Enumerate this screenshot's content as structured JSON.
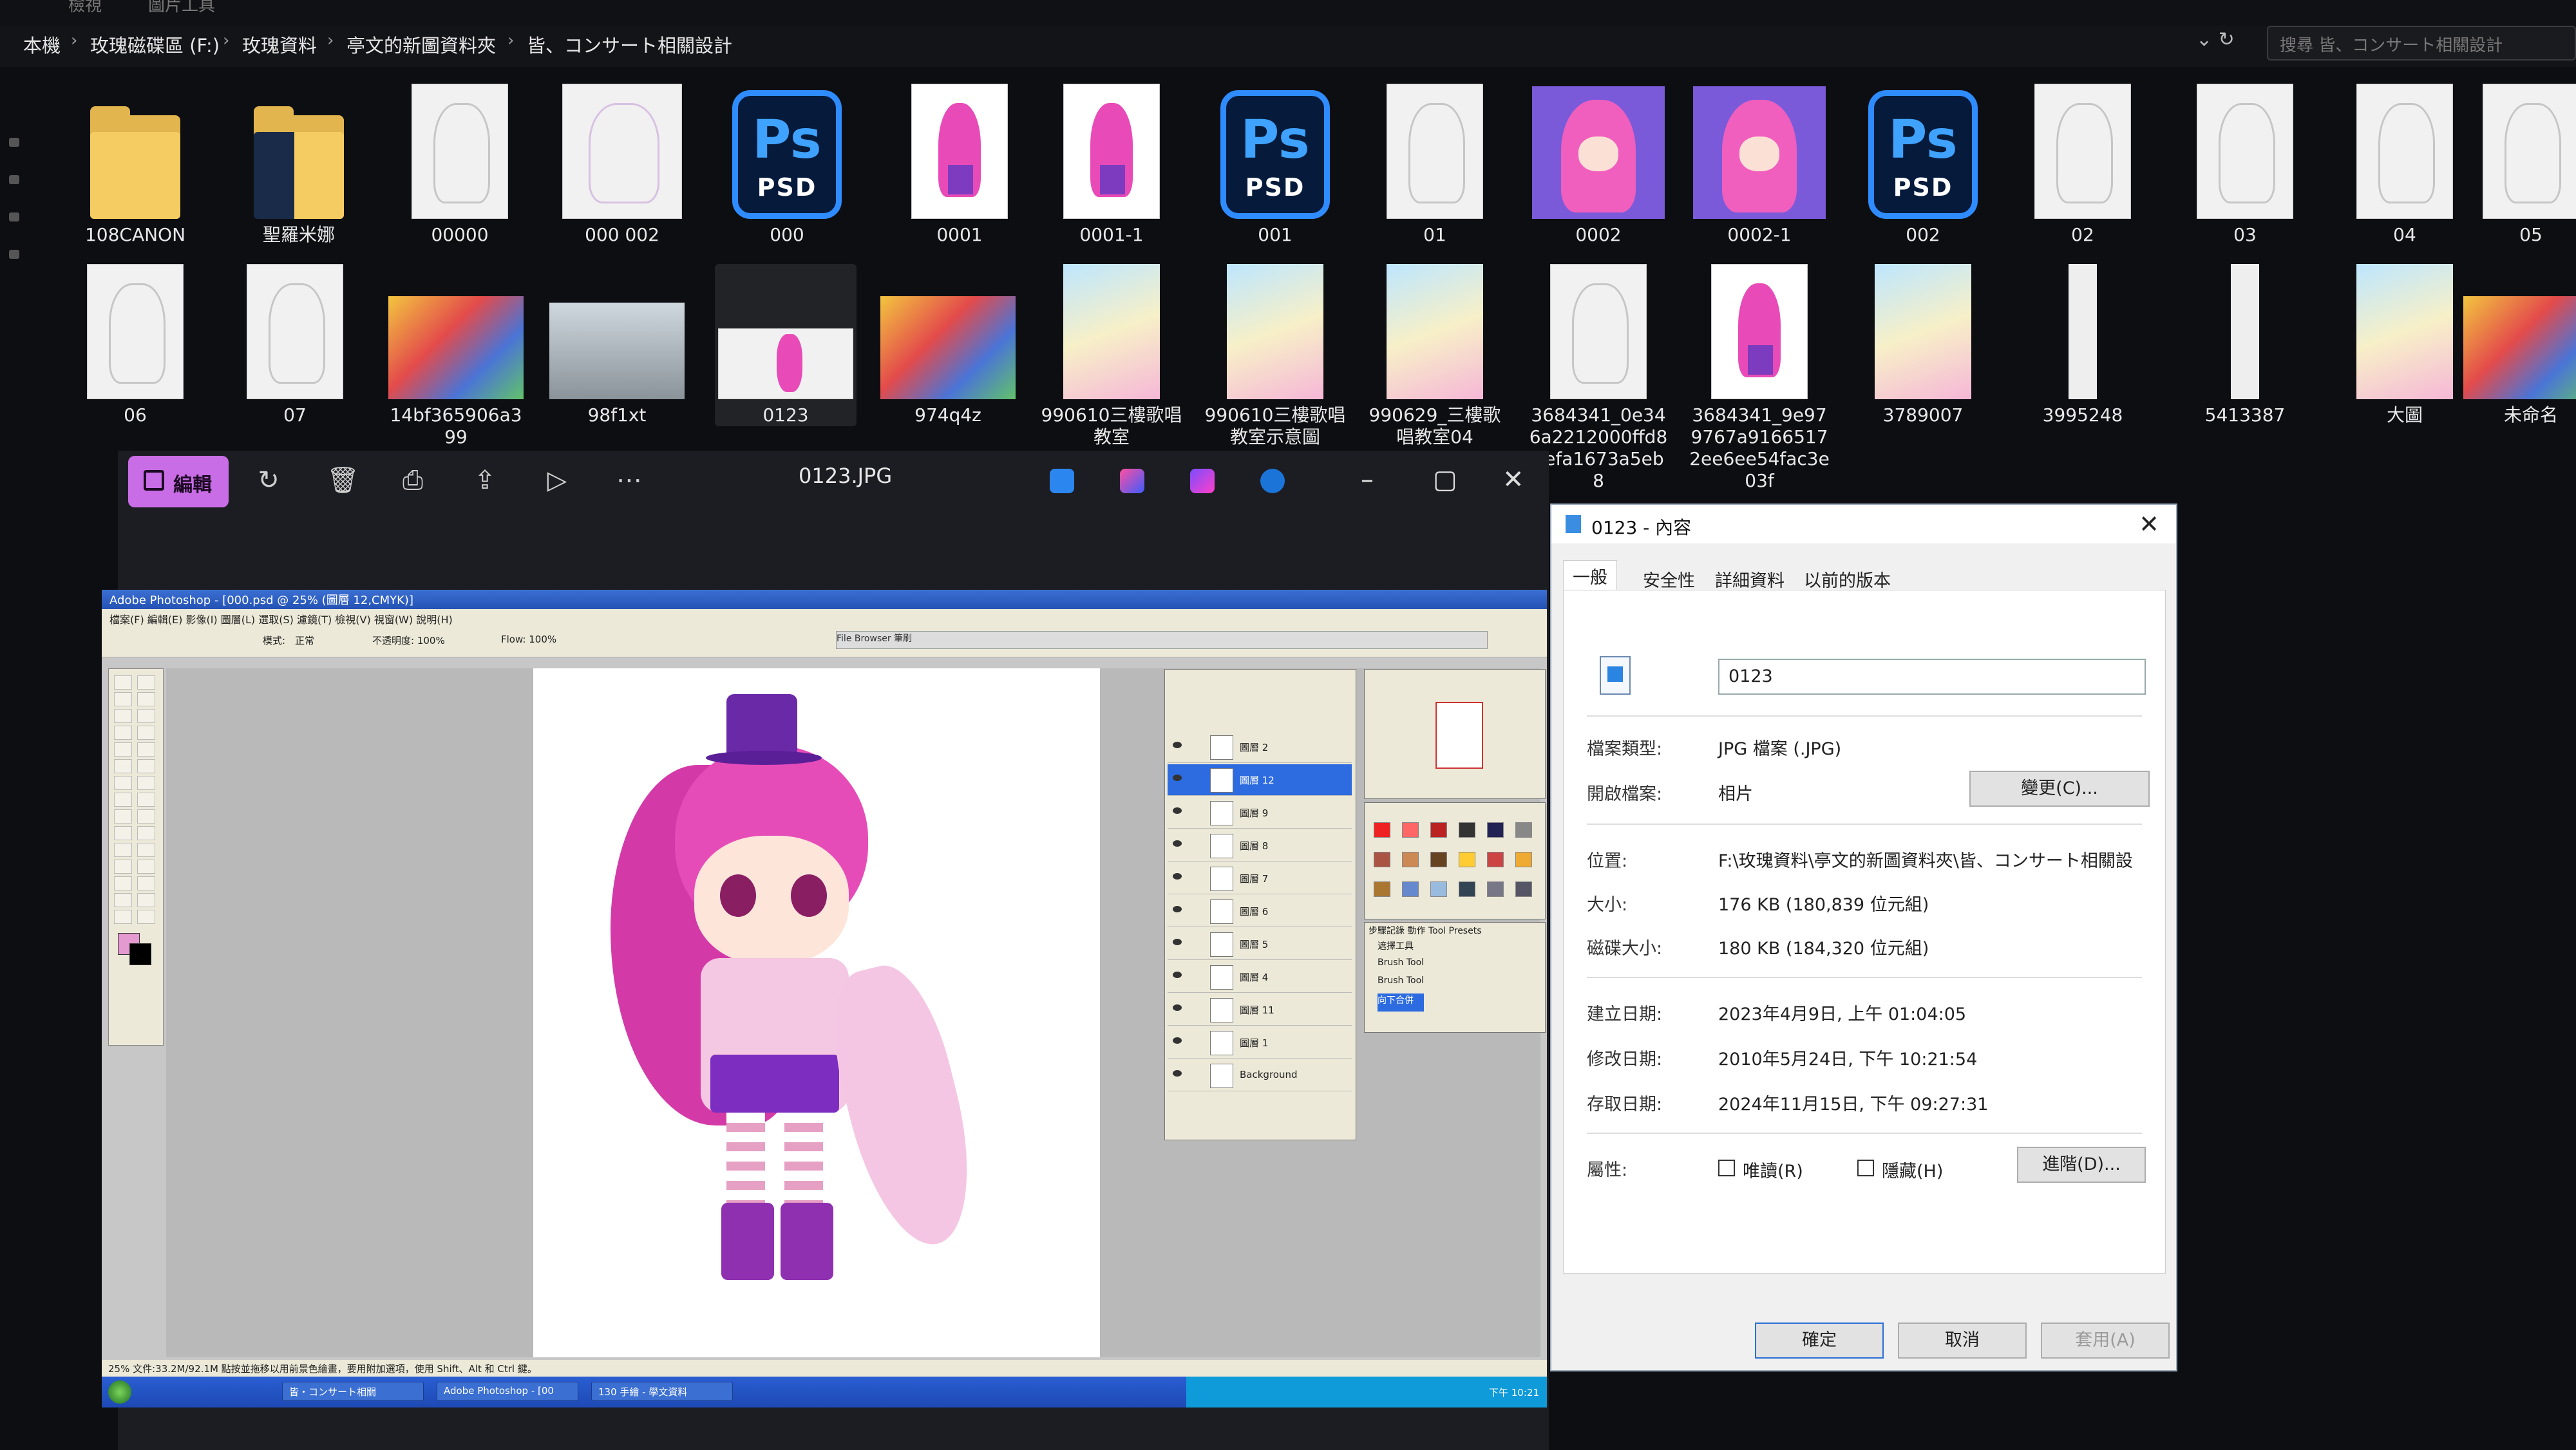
{
  "explorer": {
    "menu": [
      "檢視",
      "圖片工具"
    ],
    "breadcrumbs": [
      "本機",
      "玫瑰磁碟區 (F:)",
      "玫瑰資料",
      "亭文的新圖資料夾",
      "皆、コンサート相關設計"
    ],
    "search_placeholder": "搜尋 皆、コンサート相關設計",
    "files_row1": [
      {
        "name": "108CANON",
        "kind": "folder"
      },
      {
        "name": "聖羅米娜",
        "kind": "folder-psd"
      },
      {
        "name": "00000",
        "kind": "sketch"
      },
      {
        "name": "000 002",
        "kind": "purple-sketch"
      },
      {
        "name": "000",
        "kind": "psd"
      },
      {
        "name": "0001",
        "kind": "pinkgirl"
      },
      {
        "name": "0001-1",
        "kind": "pinkgirl"
      },
      {
        "name": "001",
        "kind": "psd"
      },
      {
        "name": "01",
        "kind": "sketch"
      },
      {
        "name": "0002",
        "kind": "dotbg"
      },
      {
        "name": "0002-1",
        "kind": "dotbg"
      },
      {
        "name": "002",
        "kind": "psd"
      },
      {
        "name": "02",
        "kind": "sketch"
      },
      {
        "name": "03",
        "kind": "sketch"
      },
      {
        "name": "04",
        "kind": "sketch"
      },
      {
        "name": "05",
        "kind": "sketch"
      }
    ],
    "files_row2": [
      {
        "name": "06",
        "kind": "sketch"
      },
      {
        "name": "07",
        "kind": "sketch"
      },
      {
        "name": "14bf365906a399",
        "kind": "colorful"
      },
      {
        "name": "98f1xt",
        "kind": "ship"
      },
      {
        "name": "0123",
        "kind": "selected"
      },
      {
        "name": "974q4z",
        "kind": "colorful"
      },
      {
        "name": "990610三樓歌唱教室",
        "kind": "poster"
      },
      {
        "name": "990610三樓歌唱教室示意圖",
        "kind": "poster"
      },
      {
        "name": "990629_三樓歌唱教室04",
        "kind": "poster"
      },
      {
        "name": "3684341_0e346a2212000ffd89efa1673a5eb8",
        "kind": "sketch"
      },
      {
        "name": "3684341_9e979767a91665172ee6ee54fac3e03f",
        "kind": "pinkgirl"
      },
      {
        "name": "3789007",
        "kind": "poster"
      },
      {
        "name": "3995248",
        "kind": "strip"
      },
      {
        "name": "5413387",
        "kind": "strip"
      },
      {
        "name": "大圖",
        "kind": "poster"
      },
      {
        "name": "未命名",
        "kind": "colorful"
      }
    ]
  },
  "viewer": {
    "edit_label": "編輯",
    "title": "0123.JPG",
    "icons": [
      "rotate-icon",
      "delete-icon",
      "print-icon",
      "share-icon",
      "slideshow-icon",
      "more-icon"
    ]
  },
  "photoshop": {
    "title": "Adobe Photoshop - [000.psd @ 25% (圖層 12,CMYK)]",
    "menu": "檔案(F)  編輯(E)  影像(I)  圖層(L)  選取(S)  濾鏡(T)  檢視(V)  視窗(W)  說明(H)",
    "opt_mode_label": "模式:",
    "opt_mode_value": "正常",
    "opt_opacity": "不透明度: 100%",
    "opt_flow": "Flow: 100%",
    "well_tabs": "File Browser    筆刷",
    "layers": [
      "圖層 2",
      "圖層 12",
      "圖層 9",
      "圖層 8",
      "圖層 7",
      "圖層 6",
      "圖層 5",
      "圖層 4",
      "圖層 11",
      "圖層 1",
      "Background"
    ],
    "active_layer_index": 1,
    "history_items": [
      "遮擇工具",
      "Brush Tool",
      "Brush Tool",
      "向下合併"
    ],
    "history_tabs": "步驟記錄  動作  Tool Presets",
    "status": "25%    文件:33.2M/92.1M    點按並拖移以用前景色繪畫，要用附加選項，使用 Shift、Alt 和 Ctrl 鍵。",
    "taskbar": [
      "皆・コンサート相關",
      "Adobe Photoshop - [00",
      "130 手繪 - 學文資料"
    ],
    "clock": "下午 10:21"
  },
  "properties": {
    "title": "0123 - 內容",
    "tabs": [
      "一般",
      "安全性",
      "詳細資料",
      "以前的版本"
    ],
    "name": "0123",
    "rows": [
      {
        "label": "檔案類型:",
        "value": "JPG 檔案 (.JPG)"
      },
      {
        "label": "開啟檔案:",
        "value": "相片"
      },
      {
        "label": "位置:",
        "value": "F:\\玫瑰資料\\亭文的新圖資料夾\\皆、コンサート相關設"
      },
      {
        "label": "大小:",
        "value": "176 KB (180,839 位元組)"
      },
      {
        "label": "磁碟大小:",
        "value": "180 KB (184,320 位元組)"
      },
      {
        "label": "建立日期:",
        "value": "2023年4月9日, 上午 01:04:05"
      },
      {
        "label": "修改日期:",
        "value": "2010年5月24日, 下午 10:21:54"
      },
      {
        "label": "存取日期:",
        "value": "2024年11月15日, 下午 09:27:31"
      },
      {
        "label": "屬性:",
        "value": ""
      }
    ],
    "change_button": "變更(C)...",
    "readonly_label": "唯讀(R)",
    "hidden_label": "隱藏(H)",
    "advanced_button": "進階(D)...",
    "ok_button": "確定",
    "cancel_button": "取消",
    "apply_button": "套用(A)"
  },
  "colors": {
    "accent_edit": "#c96de6",
    "psd_blue": "#2f8cff",
    "folder": "#f5cc62",
    "layer_active": "#2c6be0"
  }
}
